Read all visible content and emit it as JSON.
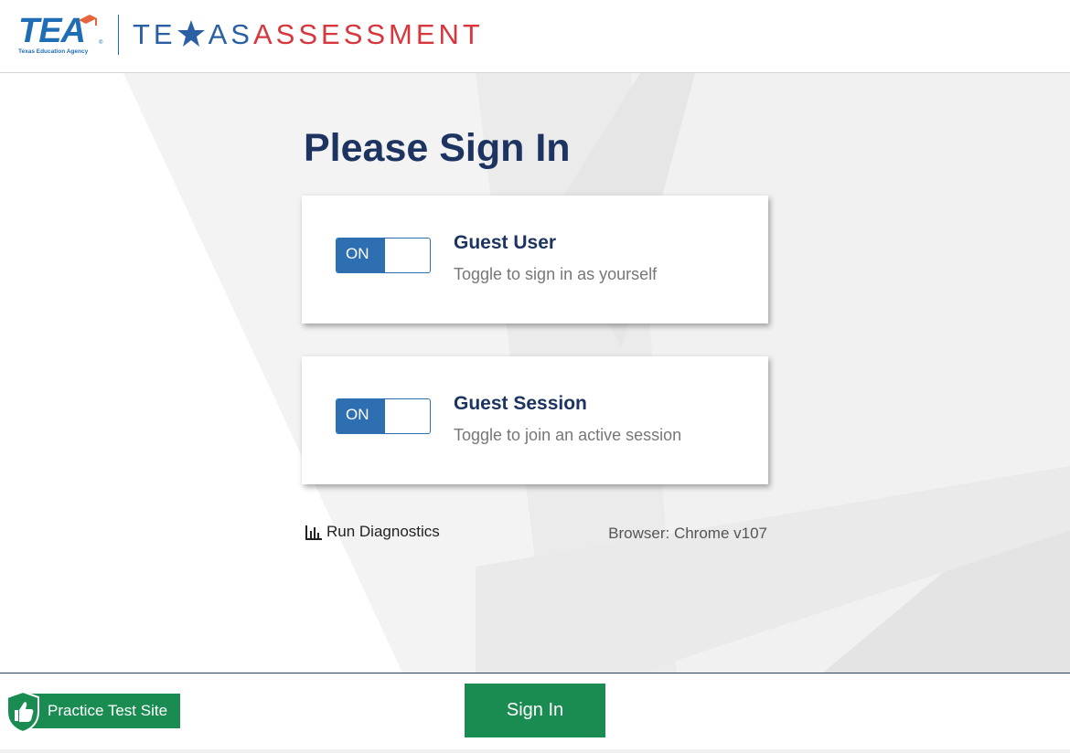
{
  "header": {
    "logo_text": "TEA",
    "logo_subtext": "Texas Education Agency",
    "brand_part1": "TE",
    "brand_part2": "AS",
    "brand_part3": "ASSESSMENT"
  },
  "main": {
    "title": "Please Sign In",
    "cards": [
      {
        "toggle_label": "ON",
        "title": "Guest User",
        "description": "Toggle to sign in as yourself"
      },
      {
        "toggle_label": "ON",
        "title": "Guest Session",
        "description": "Toggle to join an active session"
      }
    ],
    "diagnostics_label": "Run Diagnostics",
    "browser_info": "Browser: Chrome v107"
  },
  "footer": {
    "practice_label": "Practice Test Site",
    "signin_label": "Sign In"
  },
  "colors": {
    "navy": "#1d3461",
    "blue": "#2e6fb2",
    "red": "#d8363d",
    "green": "#1a8c52"
  },
  "icons": {
    "star": "star-icon",
    "diagnostics": "bar-chart-icon",
    "practice": "thumbs-up-shield-icon"
  }
}
